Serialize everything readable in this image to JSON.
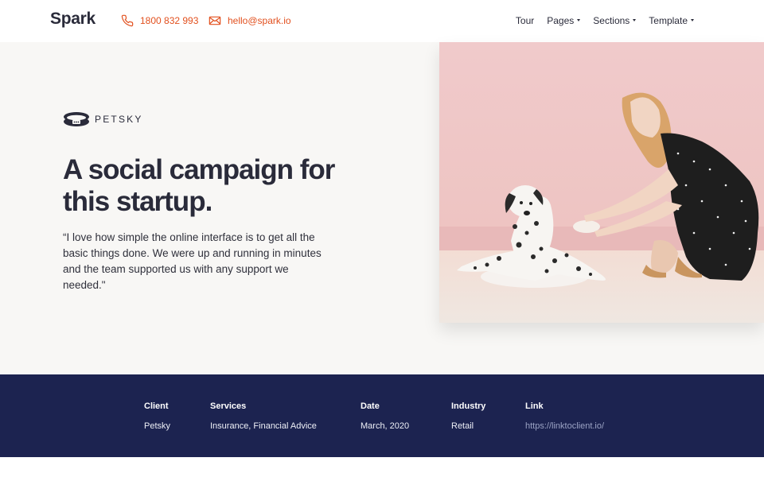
{
  "header": {
    "brand": "Spark",
    "phone": "1800 832 993",
    "email": "hello@spark.io",
    "nav": [
      {
        "label": "Tour",
        "dropdown": false
      },
      {
        "label": "Pages",
        "dropdown": true
      },
      {
        "label": "Sections",
        "dropdown": true
      },
      {
        "label": "Template",
        "dropdown": true
      }
    ]
  },
  "hero": {
    "client_logo_text": "PETSKY",
    "headline": "A social campaign for this startup.",
    "quote": "“I love how simple the online interface is to get all the basic things done. We were up and running in minutes and the team supported us with any support we needed.\""
  },
  "details": [
    {
      "label": "Client",
      "value": "Petsky"
    },
    {
      "label": "Services",
      "value": "Insurance, Financial Advice"
    },
    {
      "label": "Date",
      "value": "March, 2020"
    },
    {
      "label": "Industry",
      "value": "Retail"
    },
    {
      "label": "Link",
      "value": "https://linktoclient.io/"
    }
  ],
  "colors": {
    "accent": "#e2501e",
    "footer_bg": "#1c2350",
    "hero_bg": "#f8f7f5",
    "text_dark": "#2a2b3a"
  },
  "icons": {
    "phone": "phone-icon",
    "email": "mail-icon",
    "client_logo": "collar-logo-icon"
  }
}
